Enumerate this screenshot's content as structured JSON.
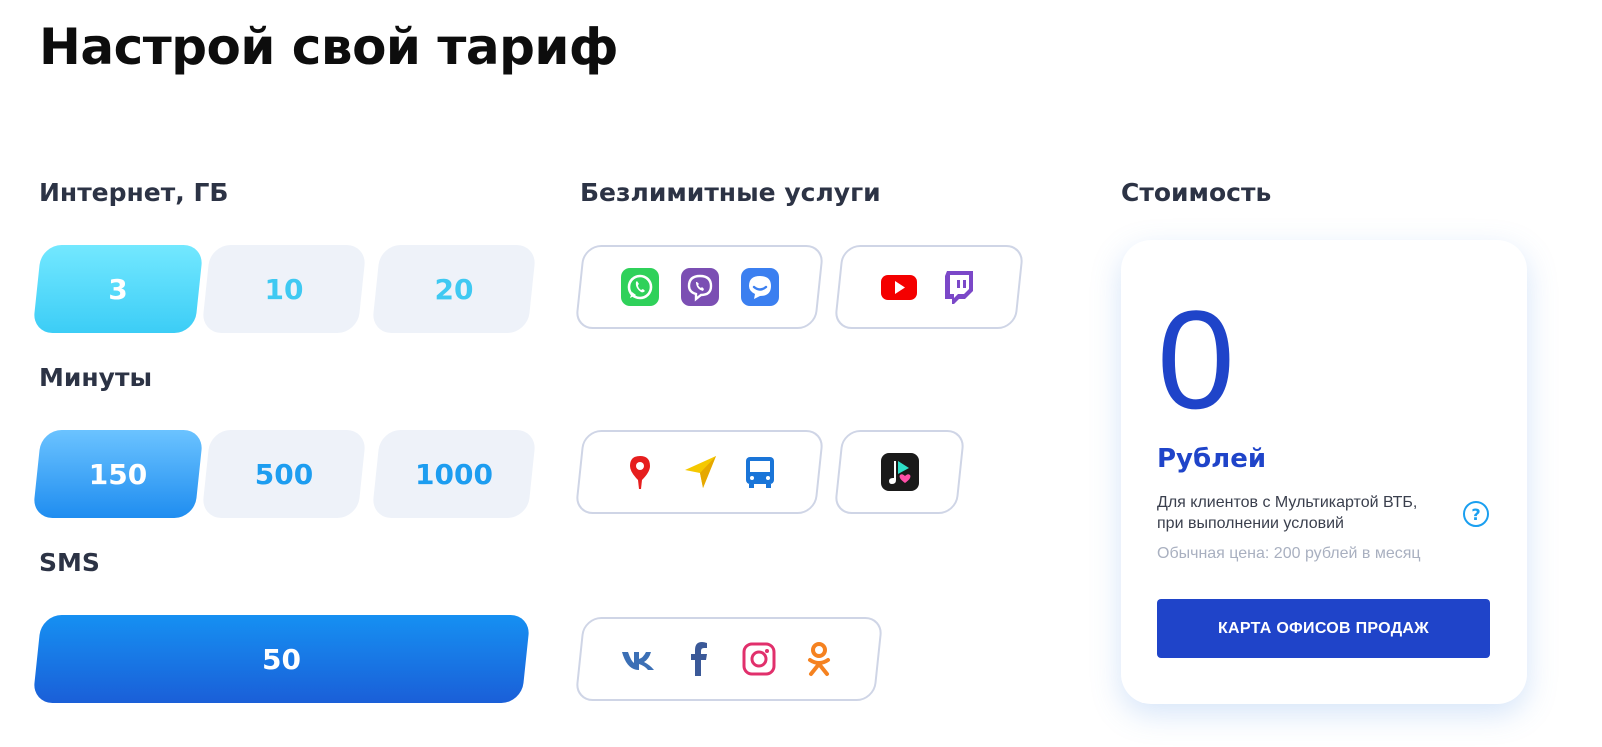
{
  "page": {
    "title": "Настрой свой тариф"
  },
  "internet": {
    "title": "Интернет, ГБ",
    "options": [
      "3",
      "10",
      "20"
    ],
    "selected": "3"
  },
  "minutes": {
    "title": "Минуты",
    "options": [
      "150",
      "500",
      "1000"
    ],
    "selected": "150"
  },
  "sms": {
    "title": "SMS",
    "options": [
      "50"
    ],
    "selected": "50"
  },
  "services": {
    "title": "Безлимитные услуги",
    "bundles": [
      {
        "icons": [
          "whatsapp-icon",
          "viber-icon",
          "messenger-icon"
        ]
      },
      {
        "icons": [
          "youtube-icon",
          "twitch-icon"
        ]
      },
      {
        "icons": [
          "map-pin-icon",
          "navigator-icon",
          "bus-icon"
        ]
      },
      {
        "icons": [
          "music-icon"
        ]
      },
      {
        "icons": [
          "vk-icon",
          "facebook-icon",
          "instagram-icon",
          "odnoklassniki-icon"
        ]
      }
    ]
  },
  "price": {
    "title": "Стоимость",
    "value": "0",
    "unit": "Рублей",
    "condition": "Для клиентов с Мультикартой ВТБ, при выполнении условий",
    "help_symbol": "?",
    "regular": "Обычная цена: 200 рублей в месяц",
    "button_label": "КАРТА ОФИСОВ ПРОДАЖ"
  },
  "colors": {
    "accent_blue": "#1f44c9",
    "cyan": "#3ccdf6",
    "tile_bg": "#eef2f9",
    "border": "#cfd5e6"
  }
}
